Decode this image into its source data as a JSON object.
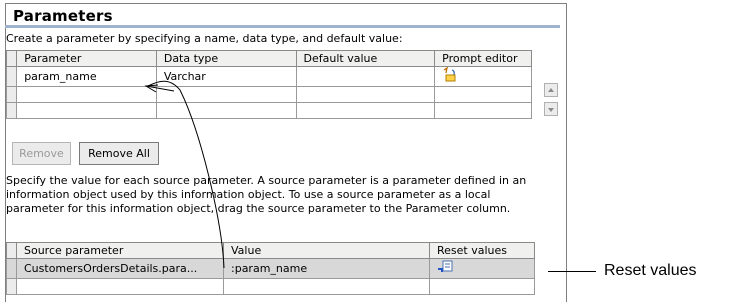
{
  "title": "Parameters",
  "intro": "Create a parameter by specifying a name, data type, and default value:",
  "param_table": {
    "headers": [
      "Parameter",
      "Data type",
      "Default value",
      "Prompt editor"
    ],
    "rows": [
      {
        "name": "param_name",
        "type": "Varchar",
        "default": ""
      }
    ]
  },
  "buttons": {
    "remove": "Remove",
    "remove_all": "Remove All"
  },
  "instructions": "Specify the value for each source parameter. A source parameter is a parameter defined in an information object used by this information object. To use a source parameter as a local parameter for this information object, drag the source parameter to the Parameter column.",
  "source_table": {
    "headers": [
      "Source parameter",
      "Value",
      "Reset values"
    ],
    "rows": [
      {
        "source": "CustomersOrdersDetails.para...",
        "value": ":param_name"
      }
    ]
  },
  "callout": "Reset values",
  "icons": {
    "prompt_editor": "prompt-editor-icon",
    "reset": "reset-values-icon",
    "scroll_up": "scroll-up-icon",
    "scroll_down": "scroll-down-icon"
  }
}
